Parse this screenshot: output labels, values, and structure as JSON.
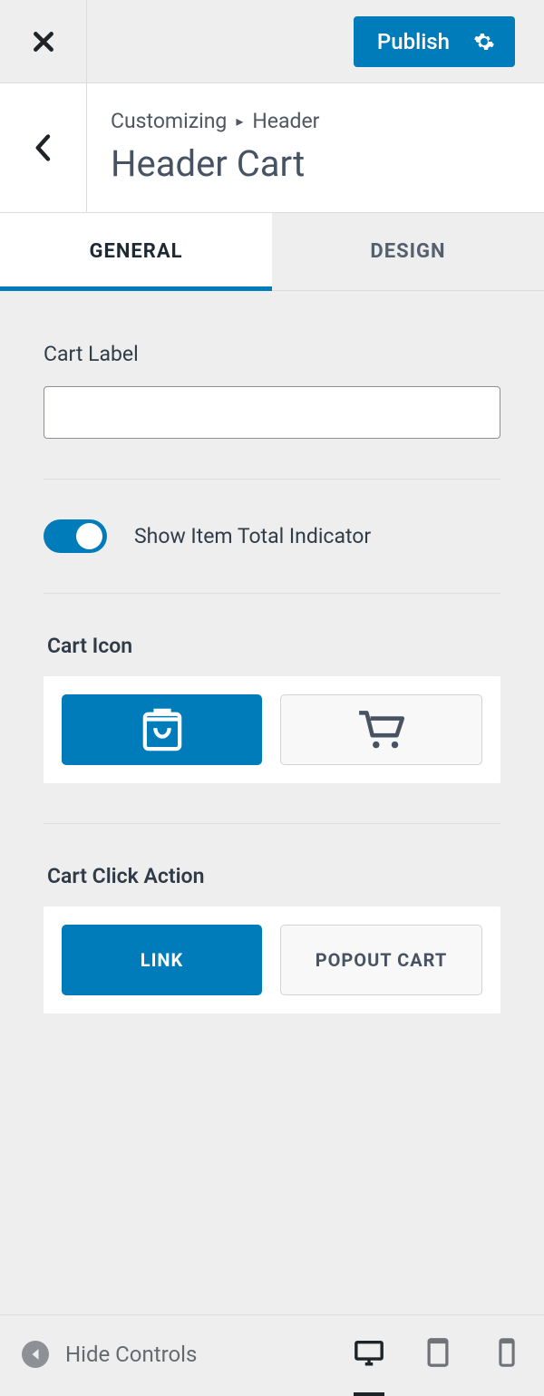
{
  "topbar": {
    "publish_label": "Publish"
  },
  "breadcrumb": {
    "root": "Customizing",
    "section": "Header"
  },
  "title": "Header Cart",
  "tabs": {
    "general": "GENERAL",
    "design": "DESIGN"
  },
  "fields": {
    "cart_label_title": "Cart Label",
    "cart_label_value": "",
    "toggle_label": "Show Item Total Indicator",
    "cart_icon_title": "Cart Icon",
    "click_action_title": "Cart Click Action",
    "click_action_link": "LINK",
    "click_action_popout": "POPOUT CART"
  },
  "footer": {
    "hide_controls": "Hide Controls"
  }
}
